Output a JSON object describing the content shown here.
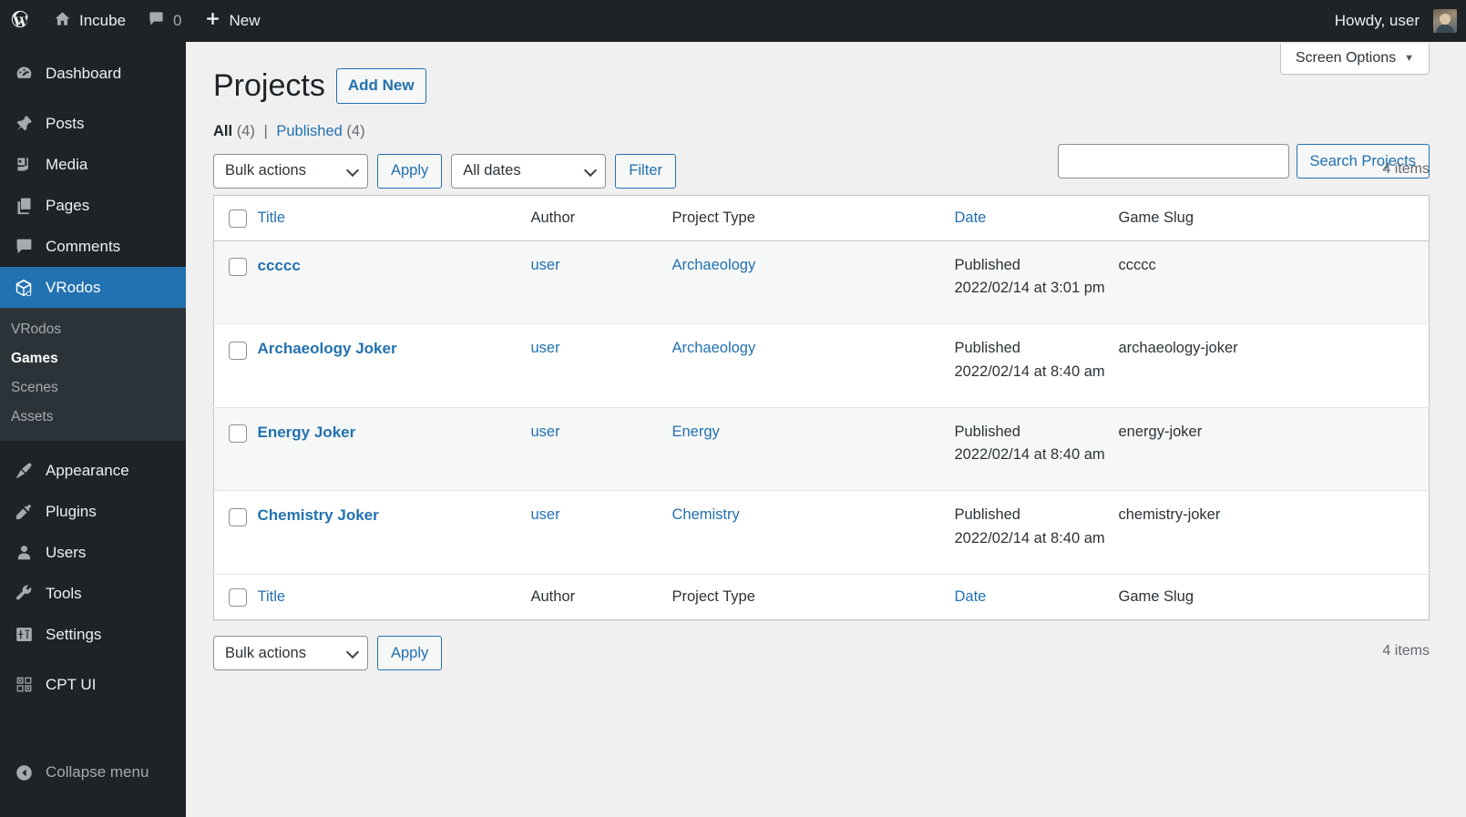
{
  "adminbar": {
    "logo_icon": "wordpress-logo-icon",
    "site_name": "Incube",
    "site_icon": "home-icon",
    "comments_icon": "comment-bubble-icon",
    "comments_count": "0",
    "new_icon": "plus-icon",
    "new_label": "New",
    "howdy": "Howdy, user",
    "avatar_name": "avatar"
  },
  "sidebar": {
    "items": [
      {
        "label": "Dashboard",
        "icon": "dashboard-icon",
        "name": "dashboard"
      },
      {
        "label": "Posts",
        "icon": "pin-icon",
        "name": "posts"
      },
      {
        "label": "Media",
        "icon": "media-icon",
        "name": "media"
      },
      {
        "label": "Pages",
        "icon": "pages-icon",
        "name": "pages"
      },
      {
        "label": "Comments",
        "icon": "comment-bubble-icon",
        "name": "comments"
      },
      {
        "label": "VRodos",
        "icon": "cube-icon",
        "name": "vrodos",
        "current": true
      },
      {
        "label": "Appearance",
        "icon": "paintbrush-icon",
        "name": "appearance"
      },
      {
        "label": "Plugins",
        "icon": "plug-icon",
        "name": "plugins"
      },
      {
        "label": "Users",
        "icon": "user-icon",
        "name": "users"
      },
      {
        "label": "Tools",
        "icon": "wrench-icon",
        "name": "tools"
      },
      {
        "label": "Settings",
        "icon": "sliders-icon",
        "name": "settings"
      },
      {
        "label": "CPT UI",
        "icon": "cpt-ui-grid-icon",
        "name": "cpt-ui"
      }
    ],
    "submenu": [
      {
        "label": "VRodos",
        "name": "vrodos"
      },
      {
        "label": "Games",
        "name": "games",
        "current": true
      },
      {
        "label": "Scenes",
        "name": "scenes"
      },
      {
        "label": "Assets",
        "name": "assets"
      }
    ],
    "collapse": {
      "label": "Collapse menu",
      "icon": "collapse-arrow-icon"
    }
  },
  "screen_meta": {
    "screen_options_label": "Screen Options",
    "caret": "▼"
  },
  "page": {
    "title": "Projects",
    "add_new_label": "Add New"
  },
  "views": {
    "all_label": "All",
    "all_count": "(4)",
    "separator": "|",
    "published_label": "Published",
    "published_count": "(4)"
  },
  "search": {
    "value": "",
    "placeholder": "",
    "submit_label": "Search Projects"
  },
  "tablenav": {
    "bulk_actions_label": "Bulk actions",
    "apply_label": "Apply",
    "all_dates_label": "All dates",
    "filter_label": "Filter",
    "displaying_num_top": "4 items",
    "displaying_num_bottom": "4 items"
  },
  "table": {
    "columns": [
      {
        "label": "Title",
        "link": true,
        "name": "title"
      },
      {
        "label": "Author",
        "link": false,
        "name": "author"
      },
      {
        "label": "Project Type",
        "link": false,
        "name": "project-type"
      },
      {
        "label": "Date",
        "link": true,
        "name": "date"
      },
      {
        "label": "Game Slug",
        "link": false,
        "name": "game-slug"
      }
    ],
    "rows": [
      {
        "title": "ccccc",
        "author": "user",
        "project_type": "Archaeology",
        "date_status": "Published",
        "date_value": "2022/02/14 at 3:01 pm",
        "game_slug": "ccccc"
      },
      {
        "title": "Archaeology Joker",
        "author": "user",
        "project_type": "Archaeology",
        "date_status": "Published",
        "date_value": "2022/02/14 at 8:40 am",
        "game_slug": "archaeology-joker"
      },
      {
        "title": "Energy Joker",
        "author": "user",
        "project_type": "Energy",
        "date_status": "Published",
        "date_value": "2022/02/14 at 8:40 am",
        "game_slug": "energy-joker"
      },
      {
        "title": "Chemistry Joker",
        "author": "user",
        "project_type": "Chemistry",
        "date_status": "Published",
        "date_value": "2022/02/14 at 8:40 am",
        "game_slug": "chemistry-joker"
      }
    ]
  },
  "colors": {
    "admin_bar_bg": "#1d2327",
    "sidebar_bg": "#1d2327",
    "submenu_bg": "#2c3338",
    "accent_blue": "#2271b1",
    "page_bg": "#f0f0f1",
    "row_alt_bg": "#f6f7f7",
    "border": "#c3c4c7"
  }
}
